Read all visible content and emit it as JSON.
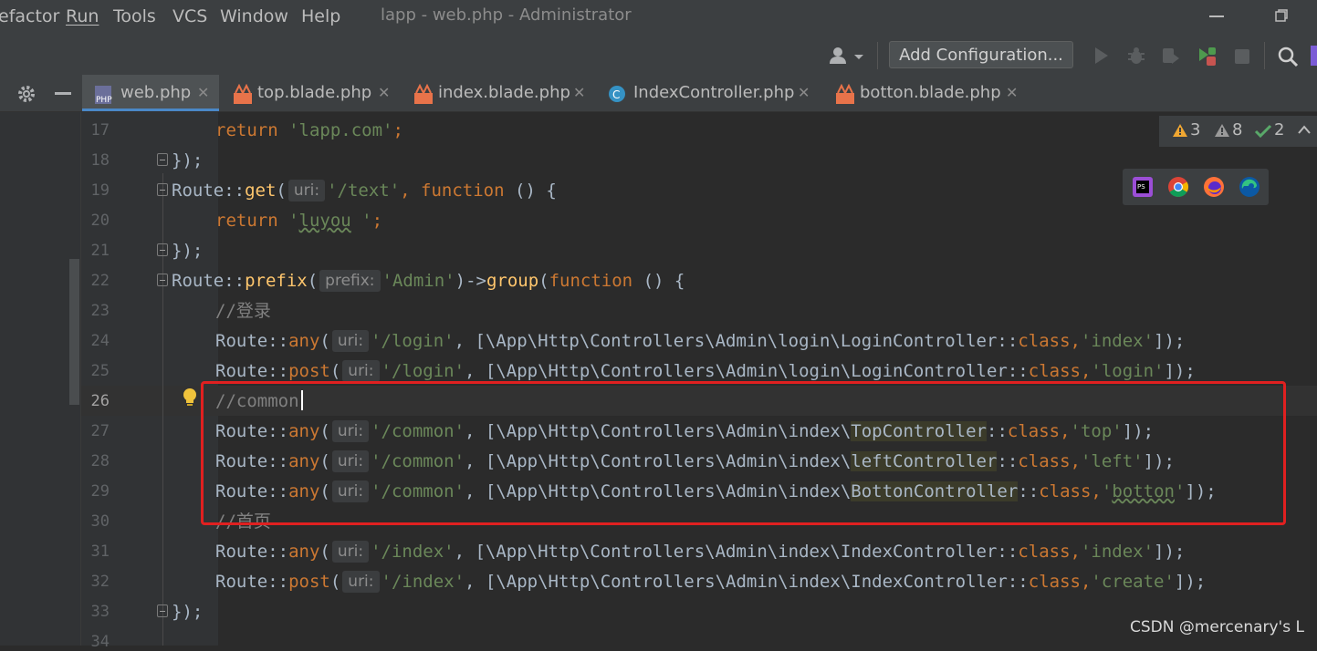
{
  "menu": {
    "items": [
      "efactor",
      "Run",
      "Tools",
      "VCS",
      "Window",
      "Help"
    ],
    "window_title": "lapp - web.php - Administrator"
  },
  "toolbar": {
    "add_config_label": "Add Configuration..."
  },
  "tabs": [
    {
      "label": "web.php",
      "icon": "php-file-icon",
      "active": true
    },
    {
      "label": "top.blade.php",
      "icon": "blade-file-icon"
    },
    {
      "label": "index.blade.php",
      "icon": "blade-file-icon"
    },
    {
      "label": "IndexController.php",
      "icon": "class-file-icon"
    },
    {
      "label": "botton.blade.php",
      "icon": "blade-file-icon"
    }
  ],
  "inspections": {
    "warnings": "3",
    "weak_warnings": "8",
    "ok": "2"
  },
  "editor": {
    "current_line": "26",
    "line_numbers": [
      "17",
      "18",
      "19",
      "20",
      "21",
      "22",
      "23",
      "24",
      "25",
      "26",
      "27",
      "28",
      "29",
      "30",
      "31",
      "32",
      "33",
      "34"
    ],
    "code": {
      "l17_return": "return ",
      "l17_str": "'lapp.com'",
      "l17_semi": ";",
      "l18": "});",
      "l19_a": "Route::",
      "l19_get": "get",
      "l19_paren": "(",
      "l19_hint": "uri:",
      "l19_str": "'/text'",
      "l19_comma": ", ",
      "l19_fn": "function",
      "l19_end": " () {",
      "l20_return": "return ",
      "l20_q1": "'",
      "l20_typo": "luyou",
      "l20_q2": " '",
      "l20_semi": ";",
      "l21": "});",
      "l22_a": "Route::",
      "l22_prefix": "prefix",
      "l22_paren": "(",
      "l22_hint": "prefix:",
      "l22_str": "'Admin'",
      "l22_arrow": ")->",
      "l22_group": "group",
      "l22_paren2": "(",
      "l22_fn": "function",
      "l22_end": " () {",
      "l23": "//登录",
      "l24_a": "Route::",
      "l24_m": "any",
      "l24_paren": "(",
      "l24_hint": "uri:",
      "l24_str": "'/login'",
      "l24_ns": ", [\\App\\Http\\Controllers\\Admin\\login\\LoginController::",
      "l24_cls": "class",
      "l24_comma": ",",
      "l24_str2": "'index'",
      "l24_end": "]);",
      "l25_a": "Route::",
      "l25_m": "post",
      "l25_paren": "(",
      "l25_hint": "uri:",
      "l25_str": "'/login'",
      "l25_ns": ", [\\App\\Http\\Controllers\\Admin\\login\\LoginController::",
      "l25_cls": "class",
      "l25_comma": ",",
      "l25_str2": "'login'",
      "l25_end": "]);",
      "l26": "//common",
      "l27_a": "Route::",
      "l27_m": "any",
      "l27_paren": "(",
      "l27_hint": "uri:",
      "l27_str": "'/common'",
      "l27_ns": ", [\\App\\Http\\Controllers\\Admin\\index\\",
      "l27_ctl": "TopController",
      "l27_sep": "::",
      "l27_cls": "class",
      "l27_comma": ",",
      "l27_str2": "'top'",
      "l27_end": "]);",
      "l28_a": "Route::",
      "l28_m": "any",
      "l28_paren": "(",
      "l28_hint": "uri:",
      "l28_str": "'/common'",
      "l28_ns": ", [\\App\\Http\\Controllers\\Admin\\index\\",
      "l28_ctl": "leftController",
      "l28_sep": "::",
      "l28_cls": "class",
      "l28_comma": ",",
      "l28_str2": "'left'",
      "l28_end": "]);",
      "l29_a": "Route::",
      "l29_m": "any",
      "l29_paren": "(",
      "l29_hint": "uri:",
      "l29_str": "'/common'",
      "l29_ns": ", [\\App\\Http\\Controllers\\Admin\\index\\",
      "l29_ctl": "BottonController",
      "l29_sep": "::",
      "l29_cls": "class",
      "l29_comma": ",",
      "l29_q1": "'",
      "l29_typo": "botton",
      "l29_q2": "'",
      "l29_end": "]);",
      "l30": "//首页",
      "l31_a": "Route::",
      "l31_m": "any",
      "l31_paren": "(",
      "l31_hint": "uri:",
      "l31_str": "'/index'",
      "l31_ns": ", [\\App\\Http\\Controllers\\Admin\\index\\IndexController::",
      "l31_cls": "class",
      "l31_comma": ",",
      "l31_str2": "'index'",
      "l31_end": "]);",
      "l32_a": "Route::",
      "l32_m": "post",
      "l32_paren": "(",
      "l32_hint": "uri:",
      "l32_str": "'/index'",
      "l32_ns": ", [\\App\\Http\\Controllers\\Admin\\index\\IndexController::",
      "l32_cls": "class",
      "l32_comma": ",",
      "l32_str2": "'create'",
      "l32_end": "]);",
      "l33": "});"
    }
  },
  "watermark": "CSDN @mercenary's L",
  "colors": {
    "keyword": "#cc7832",
    "string": "#6a8759",
    "method": "#ffc66d",
    "comment": "#808080",
    "highlight_box": "#e02020"
  }
}
